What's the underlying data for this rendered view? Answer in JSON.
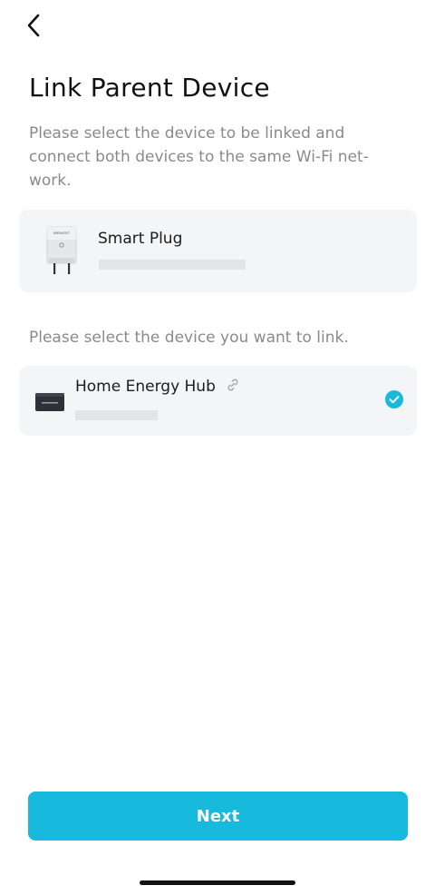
{
  "header": {
    "back_icon": "chevron-left-icon",
    "title": "Link Parent Device",
    "subtitle": "Please select the device to be linked and connect both devices to the same Wi-Fi net-work."
  },
  "parent_device": {
    "name": "Smart Plug",
    "image_label": "IMENVOLT",
    "icon": "smart-plug-icon"
  },
  "section": {
    "label": "Please select the device you want to link."
  },
  "child_device": {
    "name": "Home Energy Hub",
    "icon": "home-energy-hub-icon",
    "link_icon": "link-icon",
    "selected": true,
    "check_icon": "check-circle-icon"
  },
  "footer": {
    "next_label": "Next"
  },
  "colors": {
    "accent": "#17b9dc",
    "card_bg": "#f4f5f7",
    "muted_text": "#8a8a8a"
  }
}
